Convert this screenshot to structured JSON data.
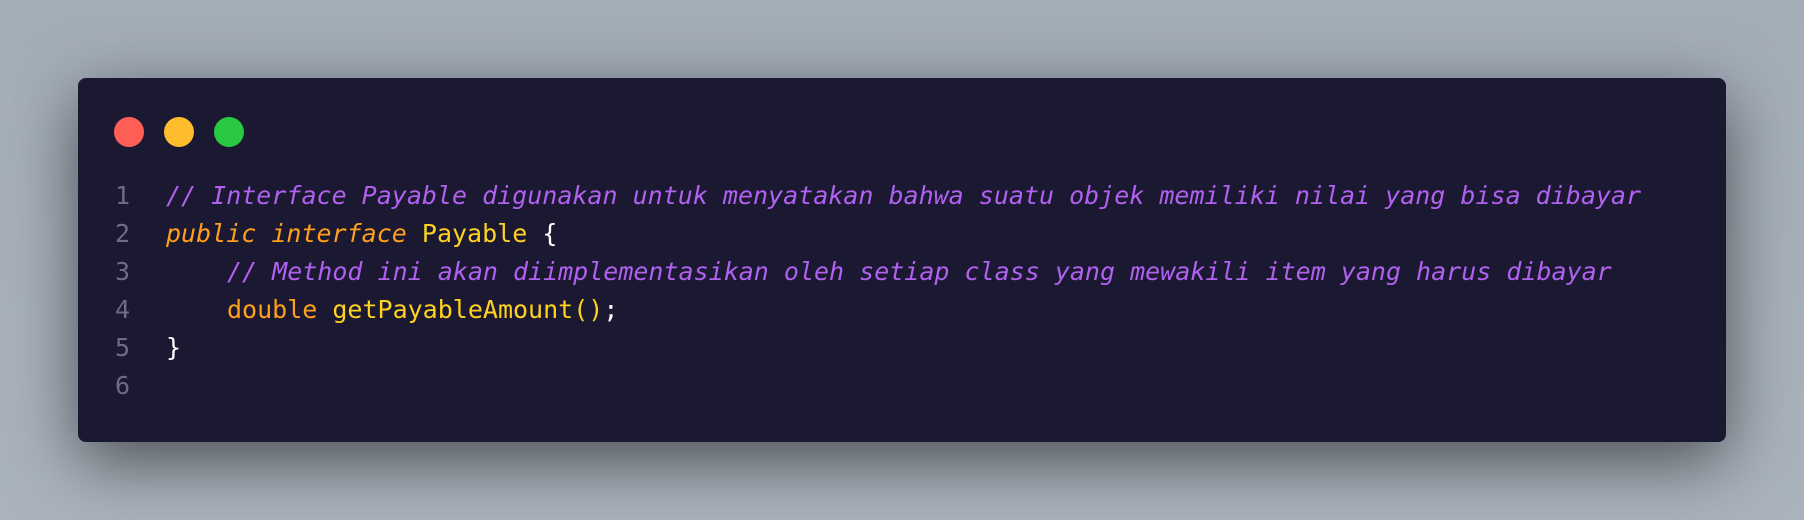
{
  "window": {
    "controls": [
      "close",
      "minimize",
      "maximize"
    ],
    "colors": {
      "background": "#1b1831",
      "close": "#ff5f57",
      "minimize": "#febc2e",
      "maximize": "#28c840",
      "comment": "#b061f0",
      "keyword": "#ff9f1c",
      "identifier": "#ffd21f",
      "line_number": "#6e6a8a"
    }
  },
  "code": {
    "lines": [
      {
        "number": "1",
        "comment": "// Interface Payable digunakan untuk menyatakan bahwa suatu objek memiliki nilai yang bisa dibayar"
      },
      {
        "number": "2",
        "kw1": "public",
        "kw2": "interface",
        "name": "Payable",
        "brace": "{"
      },
      {
        "number": "3",
        "comment": "// Method ini akan diimplementasikan oleh setiap class yang mewakili item yang harus dibayar"
      },
      {
        "number": "4",
        "type": "double",
        "method": "getPayableAmount",
        "parens": "()",
        "semicolon": ";"
      },
      {
        "number": "5",
        "brace": "}"
      },
      {
        "number": "6"
      }
    ]
  }
}
